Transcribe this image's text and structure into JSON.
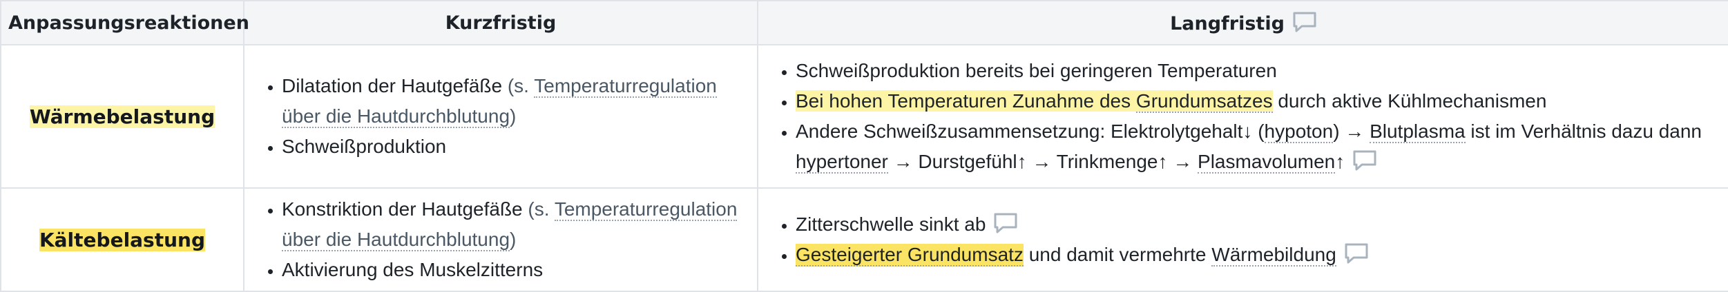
{
  "header": {
    "col1": "Anpassungsreaktionen",
    "col2": "Kurzfristig",
    "col3": "Langfristig"
  },
  "rows": [
    {
      "label": "Wärmebelastung",
      "short": [
        {
          "pre": "Dilatation der Hautgefäße ",
          "paren_open": "(s. ",
          "link": "Temperaturregulation über die Hautdurchblutung",
          "paren_close": ")"
        },
        {
          "text": "Schweißproduktion"
        }
      ],
      "long": [
        {
          "text": "Schweißproduktion bereits bei geringeren Temperaturen"
        },
        {
          "hl_a": "Bei hohen Temperaturen Zunahme des ",
          "hl_b": "Grundumsatzes",
          "rest": " durch aktive Kühlmechanismen"
        },
        {
          "a": "Andere Schweißzusammensetzung: Elektrolytgehalt↓ (",
          "b": "hypoton",
          "c": ") → ",
          "d": "Blutplasma",
          "e": " ist im Verhältnis dazu dann ",
          "f": "hypertoner",
          "g": " → Durstgefühl↑ → Trinkmenge↑ → ",
          "h": "Plasmavolumen",
          "i": "↑"
        }
      ]
    },
    {
      "label": "Kältebelastung",
      "short": [
        {
          "pre": "Konstriktion der Hautgefäße ",
          "paren_open": "(s. ",
          "link": "Temperaturregulation über die Hautdurchblutung",
          "paren_close": ")"
        },
        {
          "text": "Aktivierung des Muskelzitterns"
        }
      ],
      "long": [
        {
          "text": "Zitterschwelle sinkt ab"
        },
        {
          "hl": "Gesteigerter Grundumsatz",
          "rest": " und damit vermehrte ",
          "link": "Wärmebildung"
        }
      ]
    }
  ],
  "icons": {
    "comment": "comment-bubble",
    "comment_color": "#a9b3bd"
  },
  "colors": {
    "highlight_light": "#fdf4a6",
    "highlight_strong": "#fbe463",
    "header_bg": "#f4f5f7",
    "border": "#dfe3e8"
  }
}
